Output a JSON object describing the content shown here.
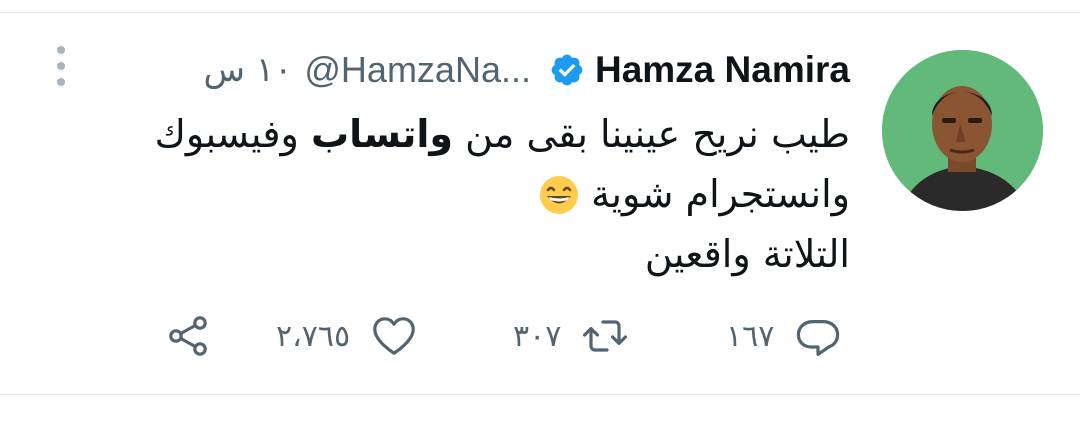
{
  "tweet": {
    "author_name": "Hamza Namira",
    "handle": "@HamzaNa...",
    "time": "١٠ س",
    "text": {
      "line1_before": "طيب نريح عينينا بقى من ",
      "line1_bold": "واتساب",
      "line1_after": " وفيسبوك",
      "line2": "وانستجرام شوية",
      "line3": "التلاتة واقعين"
    },
    "counts": {
      "replies": "١٦٧",
      "retweets": "٣٠٧",
      "likes": "٢،٧٦٥"
    }
  },
  "icons": {
    "verified": "verified-badge-icon",
    "more": "more-options-icon",
    "emoji": "grinning-face-emoji",
    "reply": "reply-icon",
    "retweet": "retweet-icon",
    "like": "heart-icon",
    "share": "share-icon"
  },
  "colors": {
    "verified_blue": "#1d9bf0",
    "secondary_text": "#536471",
    "avatar_background": "#62b97a"
  }
}
